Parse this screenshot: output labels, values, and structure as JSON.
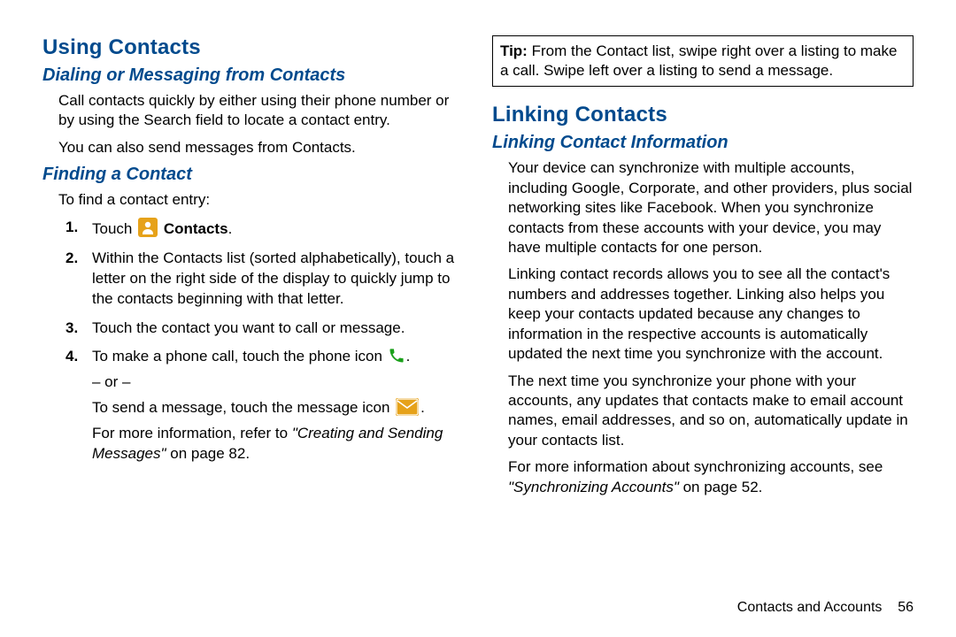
{
  "left": {
    "h1": "Using Contacts",
    "h2a": "Dialing or Messaging from Contacts",
    "p1": "Call contacts quickly by either using their phone number or by using the Search field to locate a contact entry.",
    "p2": "You can also send messages from Contacts.",
    "h2b": "Finding a Contact",
    "p3": "To find a contact entry:",
    "steps": {
      "s1_a": "Touch ",
      "s1_b": " Contacts",
      "s1_c": ".",
      "s2": "Within the Contacts list (sorted alphabetically), touch a letter on the right side of the display to quickly jump to the contacts beginning with that letter.",
      "s3": "Touch the contact you want to call or message.",
      "s4_a": "To make a phone call, touch the phone icon ",
      "s4_b": ".",
      "s4_or": "– or –",
      "s4_c": "To send a message, touch the message icon ",
      "s4_d": ".",
      "s4_e1": "For more information, refer to ",
      "s4_e2": "\"Creating and Sending Messages\"",
      "s4_e3": " on page 82."
    }
  },
  "right": {
    "tip_label": "Tip:",
    "tip_text": " From the Contact list, swipe right over a listing to make a call. Swipe left over a listing to send a message.",
    "h1": "Linking Contacts",
    "h2": "Linking Contact Information",
    "p1": "Your device can synchronize with multiple accounts, including Google, Corporate, and other providers, plus social networking sites like Facebook. When you synchronize contacts from these accounts with your device, you may have multiple contacts for one person.",
    "p2": "Linking contact records allows you to see all the contact's numbers and addresses together. Linking also helps you keep your contacts updated because any changes to information in the respective accounts is automatically updated the next time you synchronize with the account.",
    "p3": "The next time you synchronize your phone with your accounts, any updates that contacts make to email account names, email addresses, and so on, automatically update in your contacts list.",
    "p4a": "For more information about synchronizing accounts, see ",
    "p4b": "\"Synchronizing Accounts\"",
    "p4c": " on page 52."
  },
  "footer": {
    "section": "Contacts and Accounts",
    "page": "56"
  }
}
